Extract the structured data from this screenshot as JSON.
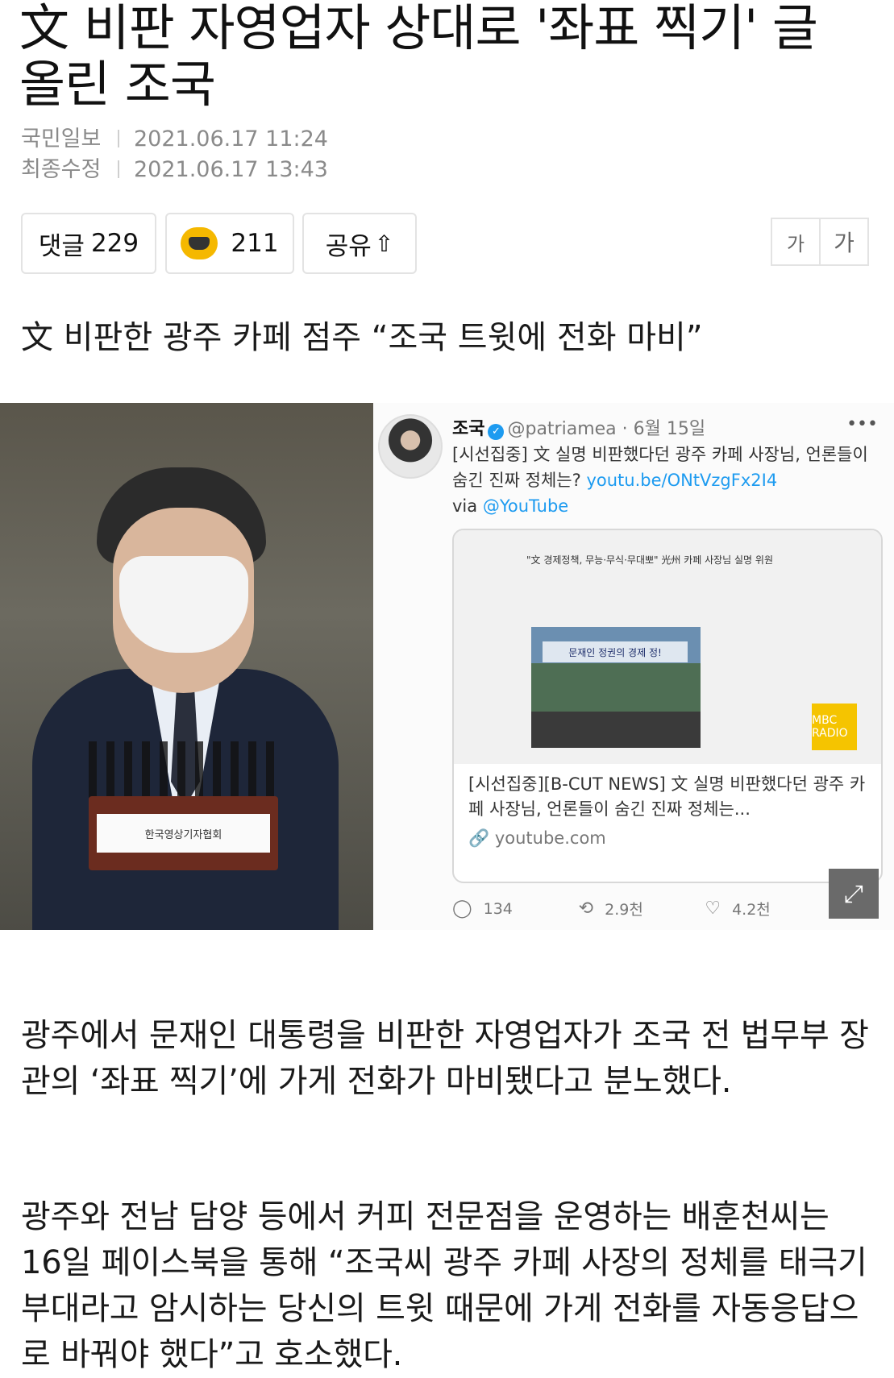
{
  "article": {
    "title": "文 비판 자영업자 상대로 '좌표 찍기' 글 올린 조국",
    "source": "국민일보",
    "published": "2021.06.17 11:24",
    "modified_label": "최종수정",
    "modified": "2021.06.17 13:43",
    "subheadline": "文 비판한 광주 카페 점주 “조국 트윗에 전화 마비”",
    "paragraphs": [
      "광주에서 문재인 대통령을 비판한 자영업자가 조국 전 법무부 장관의 ‘좌표 찍기’에 가게 전화가 마비됐다고 분노했다.",
      "광주와 전남 담양 등에서 커피 전문점을 운영하는 배훈천씨는 16일 페이스북을 통해 “조국씨 광주 카페 사장의 정체를 태극기부대라고 암시하는 당신의 트윗 때문에 가게 전화를 자동응답으로 바꿔야 했다”고 호소했다."
    ]
  },
  "actions": {
    "comment_label": "댓글",
    "comment_count": "229",
    "like_count": "211",
    "share_label": "공유",
    "font_small": "가",
    "font_large": "가"
  },
  "photo": {
    "podium_text": "한국영상기자협회"
  },
  "tweet": {
    "name": "조국",
    "handle": "@patriamea",
    "date": "6월 15일",
    "more": "•••",
    "text": "[시선집중] 文 실명 비판했다던 광주 카페 사장님, 언론들이 숨긴 진짜 정체는?",
    "link": "youtu.be/ONtVzgFx2I4",
    "via": "via",
    "via_handle": "@YouTube",
    "card": {
      "headline": "\"文 경제정책, 무능·무식·무대뽀\" 光州 카페 사장님 실명 위원",
      "banner": "문재인 정권의 경제 정!",
      "badge": "MBC RADIO",
      "title": "[시선집중][B-CUT NEWS] 文 실명 비판했다던 광주 카페 사장님, 언론들이 숨긴 진짜 정체는...",
      "domain": "youtube.com"
    },
    "replies": "134",
    "retweets": "2.9천",
    "likes": "4.2천"
  }
}
